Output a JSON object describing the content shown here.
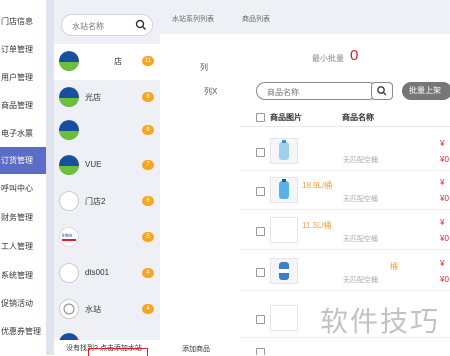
{
  "sidebar": {
    "items": [
      {
        "label": "门店信息"
      },
      {
        "label": "订单管理"
      },
      {
        "label": "用户管理"
      },
      {
        "label": "商品管理"
      },
      {
        "label": "电子水票"
      },
      {
        "label": "订货管理"
      },
      {
        "label": "呼叫中心"
      },
      {
        "label": "财务管理"
      },
      {
        "label": "工人管理"
      },
      {
        "label": "系统管理"
      },
      {
        "label": "促销活动"
      },
      {
        "label": "优惠券管理"
      }
    ],
    "active_index": 5
  },
  "stations": {
    "search_placeholder": "水站名称",
    "list": [
      {
        "name": "店",
        "badge": "11"
      },
      {
        "name": "光店",
        "badge": "8"
      },
      {
        "name": "",
        "badge": "8"
      },
      {
        "name": "VUE",
        "badge": "7"
      },
      {
        "name": "门店2",
        "badge": "6"
      },
      {
        "name": "",
        "badge": "5"
      },
      {
        "name": "dts001",
        "badge": "4"
      },
      {
        "name": "水站",
        "badge": "4"
      },
      {
        "name": "",
        "badge": ""
      }
    ],
    "footer": "没有找到? 点击添加水站"
  },
  "series": {
    "tab_label": "水站系列列表",
    "items": [
      {
        "label": "列"
      },
      {
        "label": "列X"
      }
    ],
    "add_goods": "添加商品"
  },
  "goods": {
    "tab_label": "商品列表",
    "min_batch_label": "最小批量",
    "min_batch_value": "0",
    "search_placeholder": "商品名称",
    "batch_button": "批量上架",
    "columns": [
      "商品图片",
      "商品名称"
    ],
    "rows": [
      {
        "name": "",
        "sub": "无匹配空桶",
        "price": "¥",
        "price2": "¥0"
      },
      {
        "name": "18.9L/桶",
        "sub": "无匹配空桶",
        "price": "¥",
        "price2": "¥0"
      },
      {
        "name": "11.3L/桶",
        "sub": "无匹配空桶",
        "price": "¥",
        "price2": "¥0"
      },
      {
        "name": "桶",
        "sub": "无匹配空桶",
        "price": "¥",
        "price2": "¥0"
      },
      {
        "name": "",
        "sub": "",
        "price": "",
        "price2": ""
      }
    ]
  },
  "watermark": "软件技巧",
  "colors": {
    "active_nav": "#5b6dc7",
    "badge": "#f5a623",
    "accent_red": "#e02020"
  }
}
